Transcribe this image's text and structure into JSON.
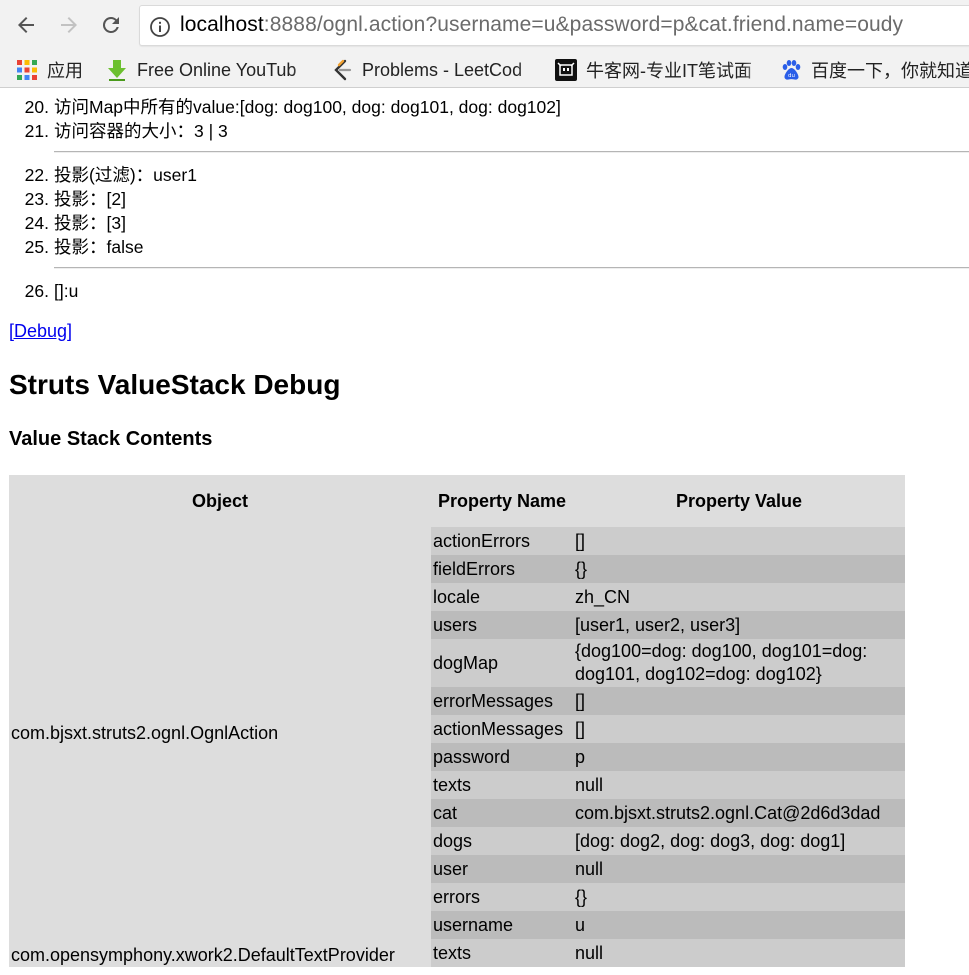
{
  "browser": {
    "url_host": "localhost",
    "url_rest": ":8888/ognl.action?username=u&password=p&cat.friend.name=oudy",
    "bookmarks": [
      {
        "label": "应用",
        "icon": "apps-grid-icon"
      },
      {
        "label": "Free Online YouTub",
        "icon": "download-arrow-icon"
      },
      {
        "label": "Problems - LeetCod",
        "icon": "leetcode-icon"
      },
      {
        "label": "牛客网-专业IT笔试面",
        "icon": "nowcoder-icon"
      },
      {
        "label": "百度一下，你就知道",
        "icon": "baidu-paw-icon"
      }
    ]
  },
  "list": {
    "item20": {
      "num": "20.",
      "text": "访问Map中所有的value:[dog: dog100, dog: dog101, dog: dog102]"
    },
    "item21": {
      "num": "21.",
      "text": "访问容器的大小：3 | 3"
    },
    "item22": {
      "num": "22.",
      "text": "投影(过滤)：user1"
    },
    "item23": {
      "num": "23.",
      "text": "投影：[2]"
    },
    "item24": {
      "num": "24.",
      "text": "投影：[3]"
    },
    "item25": {
      "num": "25.",
      "text": "投影：false"
    },
    "item26": {
      "num": "26.",
      "text": "[]:u"
    }
  },
  "debug_link": "[Debug]",
  "debug": {
    "title": "Struts ValueStack Debug",
    "subtitle": "Value Stack Contents",
    "headers": {
      "object": "Object",
      "property_name": "Property Name",
      "property_value": "Property Value"
    },
    "ognl_action": {
      "object": "com.bjsxt.struts2.ognl.OgnlAction",
      "rows": [
        {
          "name": "actionErrors",
          "value": "[]"
        },
        {
          "name": "fieldErrors",
          "value": "{}"
        },
        {
          "name": "locale",
          "value": "zh_CN"
        },
        {
          "name": "users",
          "value": "[user1, user2, user3]"
        },
        {
          "name": "dogMap",
          "value": "{dog100=dog: dog100, dog101=dog: dog101, dog102=dog: dog102}"
        },
        {
          "name": "errorMessages",
          "value": "[]"
        },
        {
          "name": "actionMessages",
          "value": "[]"
        },
        {
          "name": "password",
          "value": "p"
        },
        {
          "name": "texts",
          "value": "null"
        },
        {
          "name": "cat",
          "value": "com.bjsxt.struts2.ognl.Cat@2d6d3dad"
        },
        {
          "name": "dogs",
          "value": "[dog: dog2, dog: dog3, dog: dog1]"
        },
        {
          "name": "user",
          "value": "null"
        },
        {
          "name": "errors",
          "value": "{}"
        },
        {
          "name": "username",
          "value": "u"
        }
      ]
    },
    "text_provider": {
      "object": "com.opensymphony.xwork2.DefaultTextProvider",
      "rows": [
        {
          "name": "texts",
          "value": "null"
        }
      ]
    }
  }
}
